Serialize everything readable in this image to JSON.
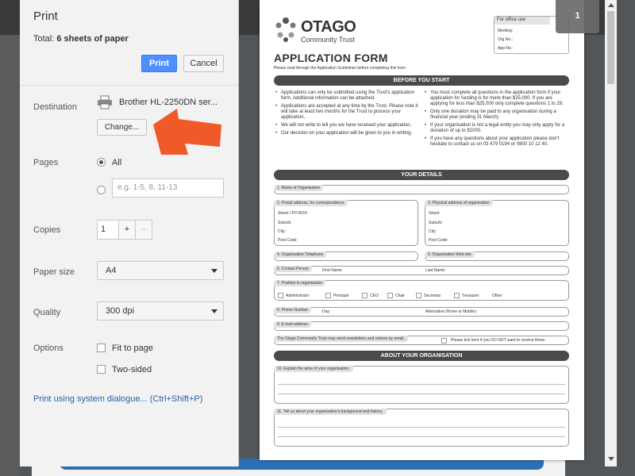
{
  "dialog": {
    "title": "Print",
    "total_prefix": "Total: ",
    "total_value": "6 sheets of paper",
    "print_label": "Print",
    "cancel_label": "Cancel",
    "destination_label": "Destination",
    "destination_name": "Brother HL-2250DN ser...",
    "change_label": "Change...",
    "pages_label": "Pages",
    "pages_all": "All",
    "pages_placeholder": "e.g. 1-5, 8, 11-13",
    "copies_label": "Copies",
    "copies_value": "1",
    "copies_plus": "+",
    "copies_minus": "–",
    "paper_label": "Paper size",
    "paper_value": "A4",
    "quality_label": "Quality",
    "quality_value": "300 dpi",
    "options_label": "Options",
    "opt_fit": "Fit to page",
    "opt_twosided": "Two-sided",
    "system_dialog_link": "Print using system dialogue... (Ctrl+Shift+P)",
    "page_count_badge": "1"
  },
  "preview": {
    "logo_title": "OTAGO",
    "logo_subtitle": "Community Trust",
    "office": {
      "head": "For office use",
      "meeting": "Meeting:",
      "org_no": "Org No.:",
      "app_no": "App No.:"
    },
    "form_title": "APPLICATION FORM",
    "form_subtitle": "Please read through the Application Guidelines before completing this form.",
    "sec_before": "BEFORE YOU START",
    "bullets_left": [
      "Applications can only be submitted using the Trust's application form. Additional information can be attached.",
      "Applications are accepted at any time by the Trust. Please note it will take at least two months for the Trust to process your application.",
      "We will not write to tell you we have received your application.",
      "Our decision on your application will be given to you in writing."
    ],
    "bullets_right": [
      "You must complete all questions in the application form if your application for funding is for more than $25,000. If you are applying for less than $25,000 only complete questions 1 to 29.",
      "Only one donation may be paid to any organisation during a financial year (ending 31 March).",
      "If your organisation is not a legal entity you may only apply for a donation of up to $1000.",
      "If you have any questions about your application please don't hesitate to contact us on 03 479 0194 or 0800 10 12 40."
    ],
    "sec_details": "YOUR DETAILS",
    "f1": "1. Name of Organisation",
    "f2": "2. Postal address, for correspondence",
    "f3": "3. Physical address of organisation",
    "street_po": "Street / PO BOX:",
    "street": "Street:",
    "suburb": "Suburb:",
    "city": "City:",
    "post_code": "Post Code:",
    "f4": "4. Organisation Telephone",
    "f5": "5. Organisation Web site",
    "f6": "6. Contact Person",
    "first_name": "First Name:",
    "last_name": "Last Name:",
    "f7": "7. Position in organisation",
    "positions": [
      "Administrator",
      "Principal",
      "CEO",
      "Chair",
      "Secretary",
      "Treasurer",
      "Other"
    ],
    "f8": "8. Phone Number",
    "day": "Day:",
    "alternative": "Alternative (Home or Mobile):",
    "f9": "9. E-mail address",
    "newsletter": "The Otago Community Trust may send newsletters and notices by email.",
    "newsletter_opt": "Please tick here if you DO NOT want to receive these.",
    "sec_org": "ABOUT YOUR ORGANISATION",
    "f10": "10. Explain the aims of your organisation.",
    "f11": "11. Tell us about your organisation's background and history."
  },
  "colors": {
    "accent": "#4d90fe",
    "arrow": "#f05a28",
    "section": "#4a4a4a"
  }
}
